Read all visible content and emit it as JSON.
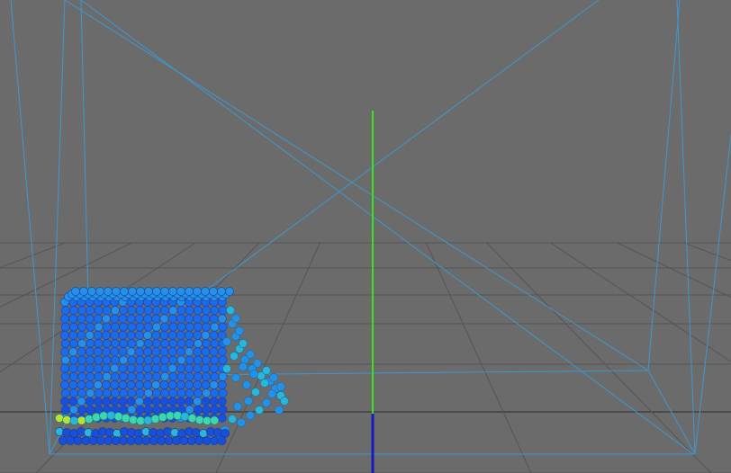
{
  "viewport": {
    "background_color": "#6b6b6b",
    "grid_color": "#555555",
    "horizon_color": "#4a4a4a"
  },
  "bounding_box": {
    "color": "#3f97cf"
  },
  "axes": {
    "y_axis_color": "#37e61a",
    "z_axis_color": "#1a1abf"
  },
  "particles": {
    "simulation": "fluid dam break",
    "colormap": [
      "#1a4fd9",
      "#1d6be8",
      "#2590e6",
      "#2ab6d9",
      "#3ed6b0",
      "#b7e23a"
    ]
  }
}
